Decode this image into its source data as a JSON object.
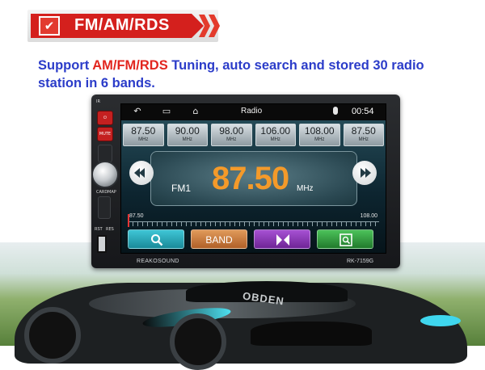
{
  "banner": {
    "label": "FM/AM/RDS",
    "check_glyph": "✔",
    "colors": {
      "red": "#d4201d",
      "chevron": "#e33b2c"
    }
  },
  "description": {
    "part1": "Support ",
    "highlight": "AM/FM/RDS",
    "part2": " Tuning, auto search and stored 30 radio station in 6 bands."
  },
  "device": {
    "brand": "REAKOSOUND",
    "model": "RK-7159G",
    "panel": {
      "ir": "IR",
      "mute": "MUTE",
      "card": "CARD",
      "map": "MAP",
      "rst": "RST",
      "res": "RES"
    }
  },
  "screen": {
    "title": "Radio",
    "time": "00:54",
    "nav_icons": [
      "back-icon",
      "recent-apps-icon",
      "home-icon"
    ],
    "presets": [
      {
        "freq": "87.50",
        "unit": "MHz"
      },
      {
        "freq": "90.00",
        "unit": "MHz"
      },
      {
        "freq": "98.00",
        "unit": "MHz"
      },
      {
        "freq": "106.00",
        "unit": "MHz"
      },
      {
        "freq": "108.00",
        "unit": "MHz"
      },
      {
        "freq": "87.50",
        "unit": "MHz"
      }
    ],
    "tuner": {
      "band": "FM1",
      "frequency": "87.50",
      "unit": "MHz",
      "frequency_color": "#f49a2a"
    },
    "scale": {
      "min": "87.50",
      "max": "108.00",
      "position": 0.0
    },
    "buttons": {
      "search_icon": "search-icon",
      "band_label": "BAND",
      "stereo_icon": "bowtie-icon",
      "list_icon": "list-search-icon",
      "colors": {
        "search": "#1aa6b8",
        "band": "#c7743a",
        "stereo": "#8a33b8",
        "list": "#2c9b3a"
      }
    }
  },
  "car": {
    "badge": "OBDEN"
  }
}
